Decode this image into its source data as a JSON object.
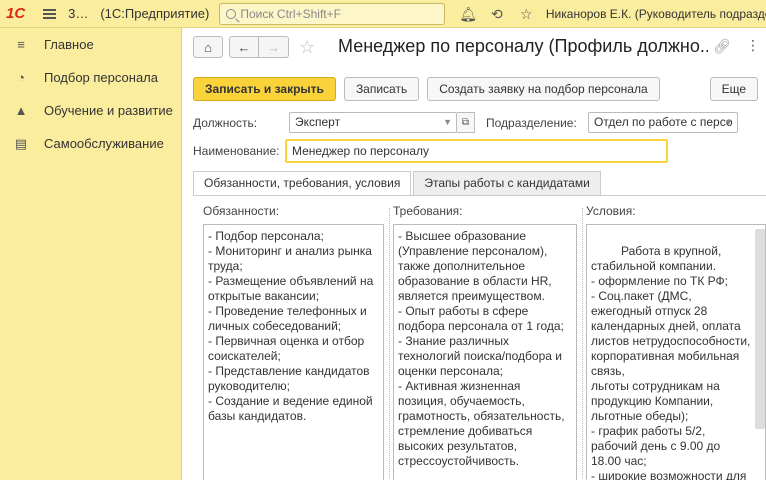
{
  "topbar": {
    "logo": "1С",
    "app_short": "3…",
    "app_name": "(1С:Предприятие)",
    "search_placeholder": "Поиск Ctrl+Shift+F",
    "user": "Никаноров Е.К. (Руководитель подразделе..."
  },
  "sidebar": {
    "items": [
      {
        "label": "Главное",
        "icon": "menu-icon"
      },
      {
        "label": "Подбор персонала",
        "icon": "ear-icon"
      },
      {
        "label": "Обучение и развитие",
        "icon": "graduation-icon"
      },
      {
        "label": "Самообслуживание",
        "icon": "id-card-icon"
      }
    ]
  },
  "header": {
    "title": "Менеджер по персоналу (Профиль должно..."
  },
  "toolbar": {
    "save_close": "Записать и закрыть",
    "save": "Записать",
    "create_request": "Создать заявку на подбор персонала",
    "more": "Еще"
  },
  "form": {
    "position_label": "Должность:",
    "position_value": "Эксперт",
    "department_label": "Подразделение:",
    "department_value": "Отдел по работе с персо",
    "name_label": "Наименование:",
    "name_value": "Менеджер по персоналу"
  },
  "tabs": [
    {
      "label": "Обязанности, требования, условия",
      "active": true
    },
    {
      "label": "Этапы работы с кандидатами",
      "active": false
    }
  ],
  "columns": {
    "duties_label": "Обязанности:",
    "duties_text": "- Подбор персонала;\n- Мониторинг и анализ рынка труда;\n- Размещение объявлений на открытые вакансии;\n- Проведение телефонных и личных собеседований;\n- Первичная оценка и отбор соискателей;\n- Представление кандидатов руководителю;\n- Создание и ведение единой базы кандидатов.",
    "requirements_label": "Требования:",
    "requirements_text": "- Высшее образование (Управление персоналом), также дополнительное образование в области HR, является преимуществом.\n- Опыт работы в сфере подбора персонала от 1 года;\n- Знание различных технологий поиска/подбора и оценки персонала;\n- Активная жизненная позиция, обучаемость, грамотность, обязательность, стремление добиваться высоких результатов, стрессоустойчивость.",
    "conditions_label": "Условия:",
    "conditions_text": " Работа в крупной, стабильной компании.\n- оформление по ТК РФ;\n- Соц.пакет (ДМС, ежегодный отпуск 28 календарных дней, оплата листов нетрудоспособности, корпоративная мобильная связь,\nльготы сотрудникам на продукцию Компании, льготные обеды);\n- график работы 5/2, рабочий день с 9.00 до 18.00 час;\n- широкие возможности для"
  }
}
